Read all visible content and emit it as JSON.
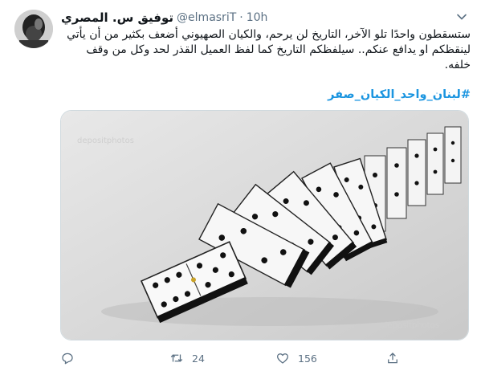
{
  "author": {
    "display_name": "توفيق س. المصري",
    "handle": "@elmasriT",
    "separator": "·",
    "time": "10h"
  },
  "tweet": {
    "text": "ستسقطون واحدًا تلو الآخر، التاريخ لن يرحم، والكيان الصهيوني أضعف بكثير من أن يأتي لينقظكم او يدافع عنكم.. سيلفظكم التاريخ كما لفظ العميل القذر لحد وكل من وقف خلفه.",
    "hashtag": "#لبنان_واحد_الكيان_صفر",
    "media_alt": "falling dominoes photo"
  },
  "actions": {
    "reply_count": "",
    "retweet_count": "24",
    "like_count": "156",
    "share_count": ""
  },
  "icons": {
    "reply": "reply-icon",
    "retweet": "retweet-icon",
    "like": "heart-icon",
    "share": "share-icon",
    "more": "chevron-down-icon"
  },
  "colors": {
    "link": "#1b95e0",
    "muted": "#5b7083",
    "text": "#0f1419"
  }
}
